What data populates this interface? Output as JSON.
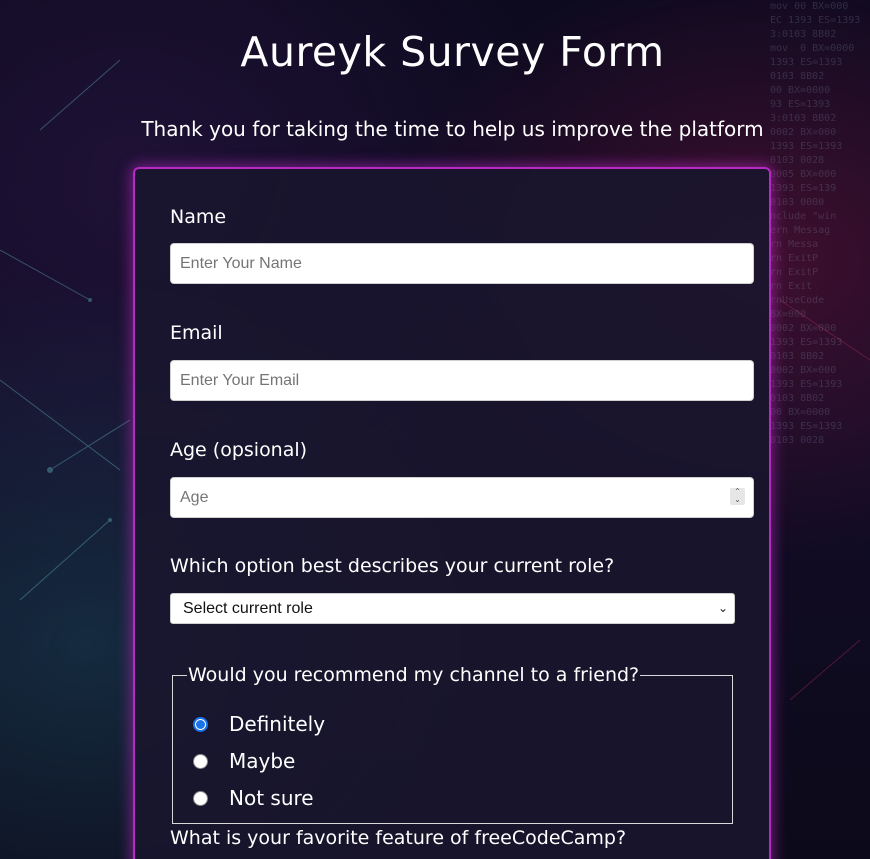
{
  "page": {
    "title": "Aureyk Survey Form",
    "subtitle": "Thank you for taking the time to help us improve the platform"
  },
  "form": {
    "name": {
      "label": "Name",
      "placeholder": "Enter Your Name",
      "value": ""
    },
    "email": {
      "label": "Email",
      "placeholder": "Enter Your Email",
      "value": ""
    },
    "age": {
      "label": "Age (opsional)",
      "placeholder": "Age",
      "value": ""
    },
    "role": {
      "label": "Which option best describes your current role?",
      "selected": "Select current role"
    },
    "recommend": {
      "legend": "Would you recommend my channel to a friend?",
      "options": [
        {
          "label": "Definitely",
          "checked": true
        },
        {
          "label": "Maybe",
          "checked": false
        },
        {
          "label": "Not sure",
          "checked": false
        }
      ]
    },
    "favorite_feature": {
      "label": "What is your favorite feature of freeCodeCamp?"
    }
  },
  "colors": {
    "accent_border": "#b52ac0",
    "radio_checked": "#1a73e8",
    "background": "#0d0a1f"
  }
}
